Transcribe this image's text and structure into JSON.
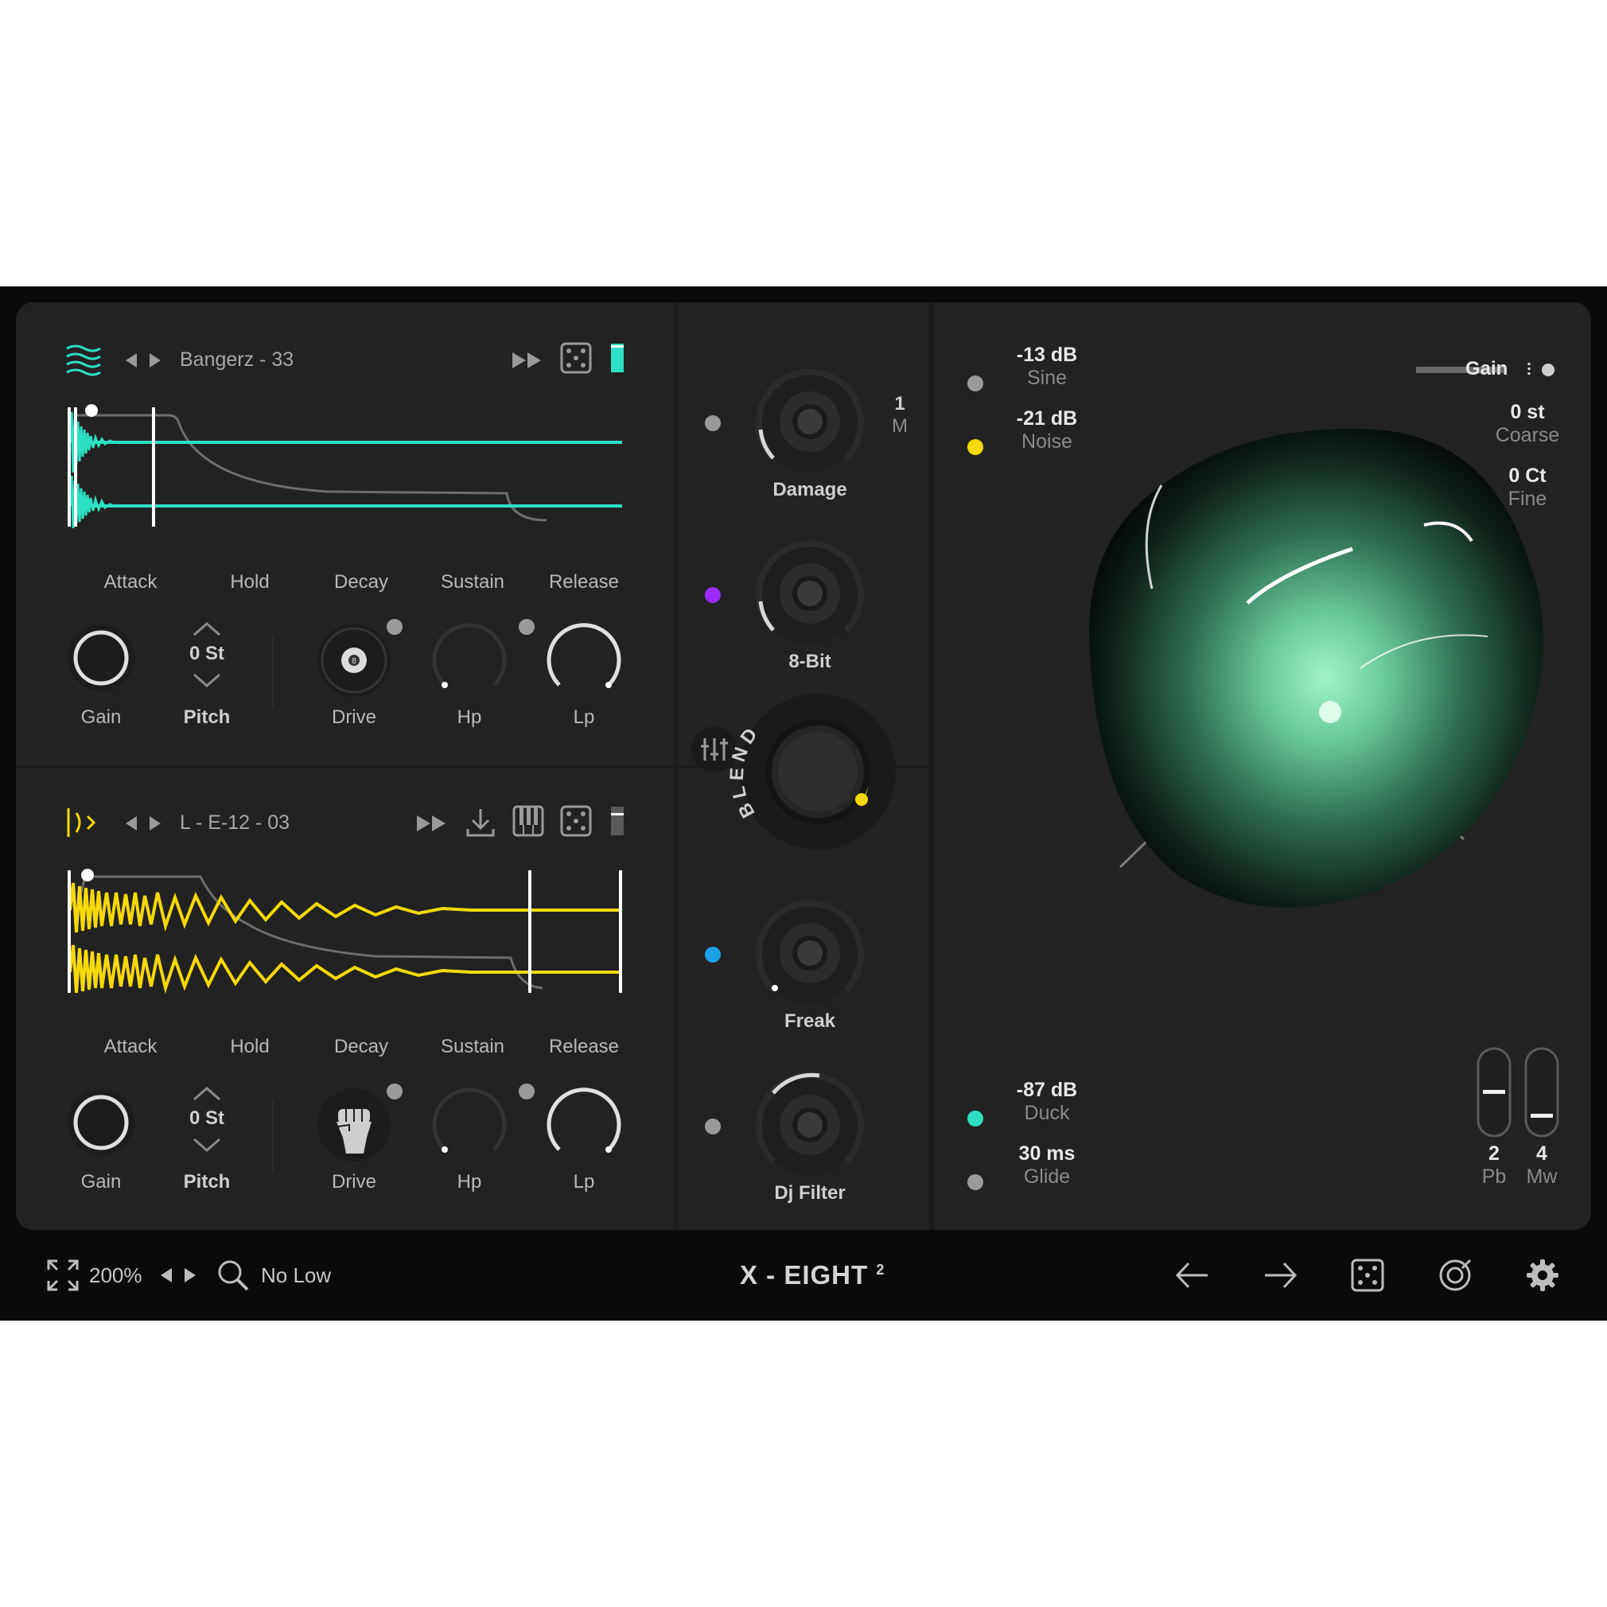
{
  "colors": {
    "teal": "#2de0c4",
    "yellow": "#f5d90a",
    "purple": "#9b2bff",
    "blue": "#1aa0e6",
    "grey_dot": "#9a9a9a",
    "panel": "#222222",
    "frame": "#0a0a0a"
  },
  "layer1": {
    "icon": "waves-icon",
    "preset": "Bangerz - 33",
    "envelope_labels": [
      "Attack",
      "Hold",
      "Decay",
      "Sustain",
      "Release"
    ],
    "pitch_value": "0 St",
    "knob_labels": {
      "gain": "Gain",
      "pitch": "Pitch",
      "drive": "Drive",
      "hp": "Hp",
      "lp": "Lp"
    },
    "drive_icon": "eight-ball-icon"
  },
  "layer2": {
    "icon": "transient-icon",
    "preset": "L - E-12 - 03",
    "envelope_labels": [
      "Attack",
      "Hold",
      "Decay",
      "Sustain",
      "Release"
    ],
    "pitch_value": "0 St",
    "knob_labels": {
      "gain": "Gain",
      "pitch": "Pitch",
      "drive": "Drive",
      "hp": "Hp",
      "lp": "Lp"
    },
    "drive_icon": "fist-icon"
  },
  "fx": {
    "damage": {
      "label": "Damage",
      "mode_top": "1",
      "mode_bottom": "M"
    },
    "bitcrush": {
      "label": "8-Bit"
    },
    "blend": {
      "label": "BLEND"
    },
    "freak": {
      "label": "Freak"
    },
    "dj_filter": {
      "label": "Dj Filter"
    }
  },
  "right": {
    "sine": {
      "value": "-13 dB",
      "label": "Sine"
    },
    "noise": {
      "value": "-21 dB",
      "label": "Noise"
    },
    "gain_label": "Gain",
    "coarse": {
      "value": "0 st",
      "label": "Coarse"
    },
    "fine": {
      "value": "0 Ct",
      "label": "Fine"
    },
    "duck": {
      "value": "-87 dB",
      "label": "Duck"
    },
    "glide": {
      "value": "30 ms",
      "label": "Glide"
    },
    "pb": {
      "value": "2",
      "label": "Pb"
    },
    "mw": {
      "value": "4",
      "label": "Mw"
    }
  },
  "bottom": {
    "zoom": "200%",
    "quality": "No Low",
    "product": "X - EIGHT",
    "product_sup": "2"
  }
}
